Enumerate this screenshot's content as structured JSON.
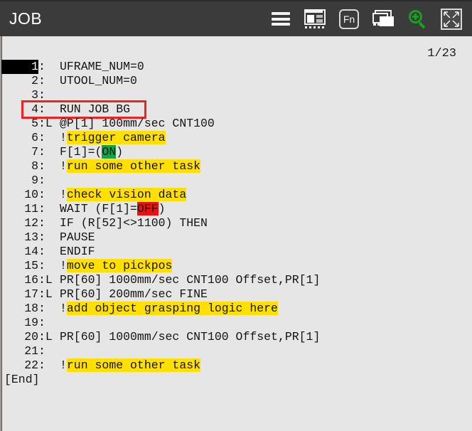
{
  "window": {
    "title": "JOB"
  },
  "toolbar": {
    "items": [
      {
        "name": "menu-icon",
        "label": "Menu"
      },
      {
        "name": "layout-icon",
        "label": "Layout"
      },
      {
        "name": "fn-icon",
        "label": "Fn"
      },
      {
        "name": "windows-icon",
        "label": "Windows"
      },
      {
        "name": "zoom-in-icon",
        "label": "Zoom In"
      },
      {
        "name": "fit-screen-icon",
        "label": "Fit Screen"
      }
    ],
    "fn_label": "Fn"
  },
  "editor": {
    "page_indicator": "1/23",
    "end_marker": "[End]",
    "cursor_line": 1,
    "boxed_line": 4,
    "lines": [
      {
        "num": "1",
        "mark": "",
        "text": "UFRAME_NUM=0"
      },
      {
        "num": "2",
        "mark": "",
        "text": "UTOOL_NUM=0"
      },
      {
        "num": "3",
        "mark": "",
        "text": ""
      },
      {
        "num": "4",
        "mark": "",
        "text": "RUN JOB BG"
      },
      {
        "num": "5",
        "mark": "L",
        "text": "@P[1] 100mm/sec CNT100"
      },
      {
        "num": "6",
        "mark": "",
        "text": "!trigger camera",
        "comment": true
      },
      {
        "num": "7",
        "mark": "",
        "text": "F[1]=(ON)",
        "flag_on": true
      },
      {
        "num": "8",
        "mark": "",
        "text": "!run some other task",
        "comment": true
      },
      {
        "num": "9",
        "mark": "",
        "text": ""
      },
      {
        "num": "10",
        "mark": "",
        "text": "!check vision data",
        "comment": true
      },
      {
        "num": "11",
        "mark": "",
        "text": "WAIT (F[1]=OFF)",
        "flag_off": true
      },
      {
        "num": "12",
        "mark": "",
        "text": "IF (R[52]<>1100) THEN"
      },
      {
        "num": "13",
        "mark": "",
        "text": "PAUSE"
      },
      {
        "num": "14",
        "mark": "",
        "text": "ENDIF"
      },
      {
        "num": "15",
        "mark": "",
        "text": "!move to pickpos",
        "comment": true
      },
      {
        "num": "16",
        "mark": "L",
        "text": "PR[60] 1000mm/sec CNT100 Offset,PR[1]"
      },
      {
        "num": "17",
        "mark": "L",
        "text": "PR[60] 200mm/sec FINE"
      },
      {
        "num": "18",
        "mark": "",
        "text": "!add object grasping logic here",
        "comment": true
      },
      {
        "num": "19",
        "mark": "",
        "text": ""
      },
      {
        "num": "20",
        "mark": "L",
        "text": "PR[60] 1000mm/sec CNT100 Offset,PR[1]"
      },
      {
        "num": "21",
        "mark": "",
        "text": ""
      },
      {
        "num": "22",
        "mark": "",
        "text": "!run some other task",
        "comment": true
      }
    ]
  },
  "colors": {
    "titlebar_bg": "#3b3b3b",
    "content_bg": "#e6e6e6",
    "highlight_comment": "#ffe000",
    "highlight_on": "#12a44a",
    "highlight_off": "#ee1111",
    "box_outline": "#ee2222",
    "zoom_icon": "#19a01e",
    "scrollbar_thumb": "#3f7cb0"
  }
}
